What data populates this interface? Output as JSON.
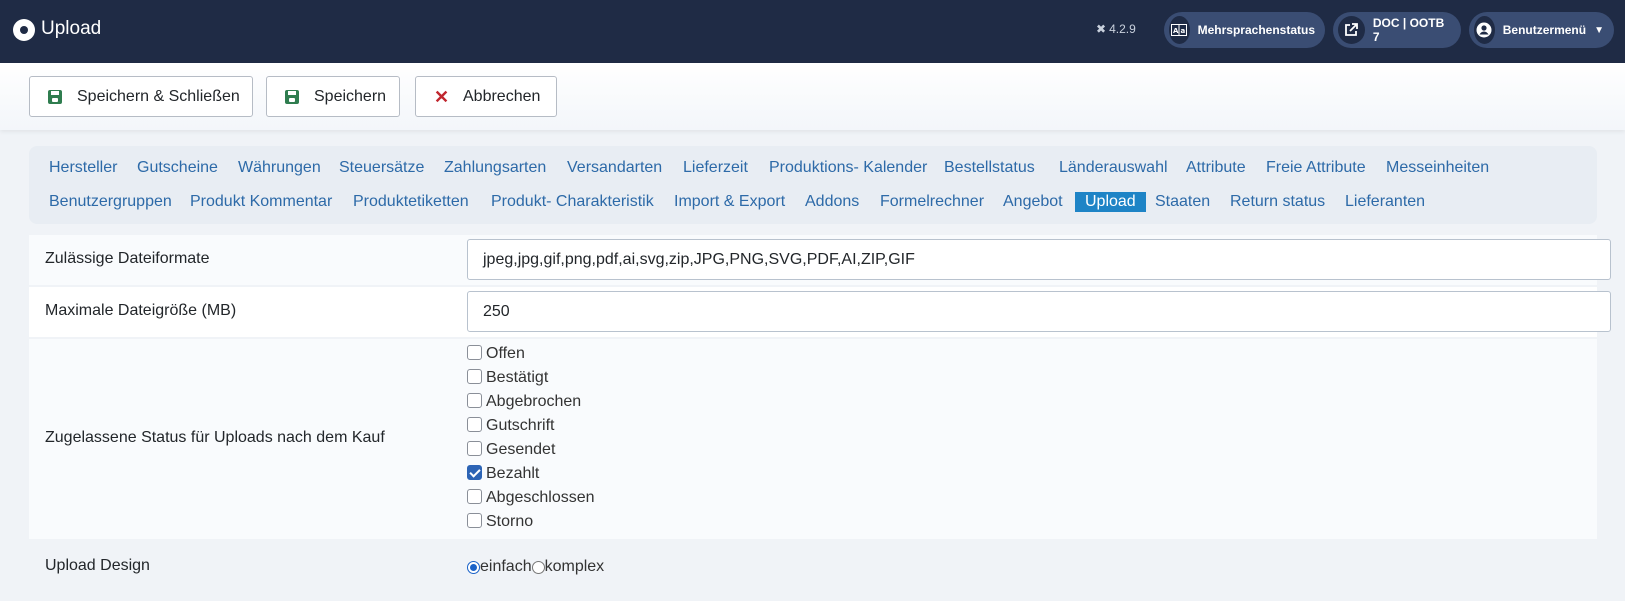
{
  "header": {
    "title": "Upload",
    "version": "4.2.9",
    "multilang_label": "Mehrsprachenstatus",
    "doc_label": "DOC | OOTB 7",
    "user_menu_label": "Benutzermenü"
  },
  "toolbar": {
    "save_close_label": "Speichern & Schließen",
    "save_label": "Speichern",
    "cancel_label": "Abbrechen"
  },
  "tabs": [
    "Hersteller",
    "Gutscheine",
    "Währungen",
    "Steuersätze",
    "Zahlungsarten",
    "Versandarten",
    "Lieferzeit",
    "Produktions- Kalender",
    "Bestellstatus",
    "Länderauswahl",
    "Attribute",
    "Freie Attribute",
    "Messeinheiten",
    "Benutzergruppen",
    "Produkt Kommentar",
    "Produktetiketten",
    "Produkt- Charakteristik",
    "Import & Export",
    "Addons",
    "Formelrechner",
    "Angebot",
    "Upload",
    "Staaten",
    "Return status",
    "Lieferanten"
  ],
  "active_tab": "Upload",
  "form": {
    "formats_label": "Zulässige Dateiformate",
    "formats_value": "jpeg,jpg,gif,png,pdf,ai,svg,zip,JPG,PNG,SVG,PDF,AI,ZIP,GIF",
    "maxsize_label": "Maximale Dateigröße (MB)",
    "maxsize_value": "250",
    "status_label": "Zugelassene Status für Uploads nach dem Kauf",
    "statuses": [
      {
        "label": "Offen",
        "checked": false
      },
      {
        "label": "Bestätigt",
        "checked": false
      },
      {
        "label": "Abgebrochen",
        "checked": false
      },
      {
        "label": "Gutschrift",
        "checked": false
      },
      {
        "label": "Gesendet",
        "checked": false
      },
      {
        "label": "Bezahlt",
        "checked": true
      },
      {
        "label": "Abgeschlossen",
        "checked": false
      },
      {
        "label": "Storno",
        "checked": false
      }
    ],
    "design_label": "Upload Design",
    "design_options": [
      {
        "label": "einfach",
        "selected": true
      },
      {
        "label": "komplex",
        "selected": false
      }
    ]
  },
  "colors": {
    "header_bg": "#1f2b45",
    "tab_link": "#2d6aa8",
    "tab_active_bg": "#1e84c6",
    "save_icon": "#2f7d4f",
    "cancel_icon": "#c0262e"
  }
}
